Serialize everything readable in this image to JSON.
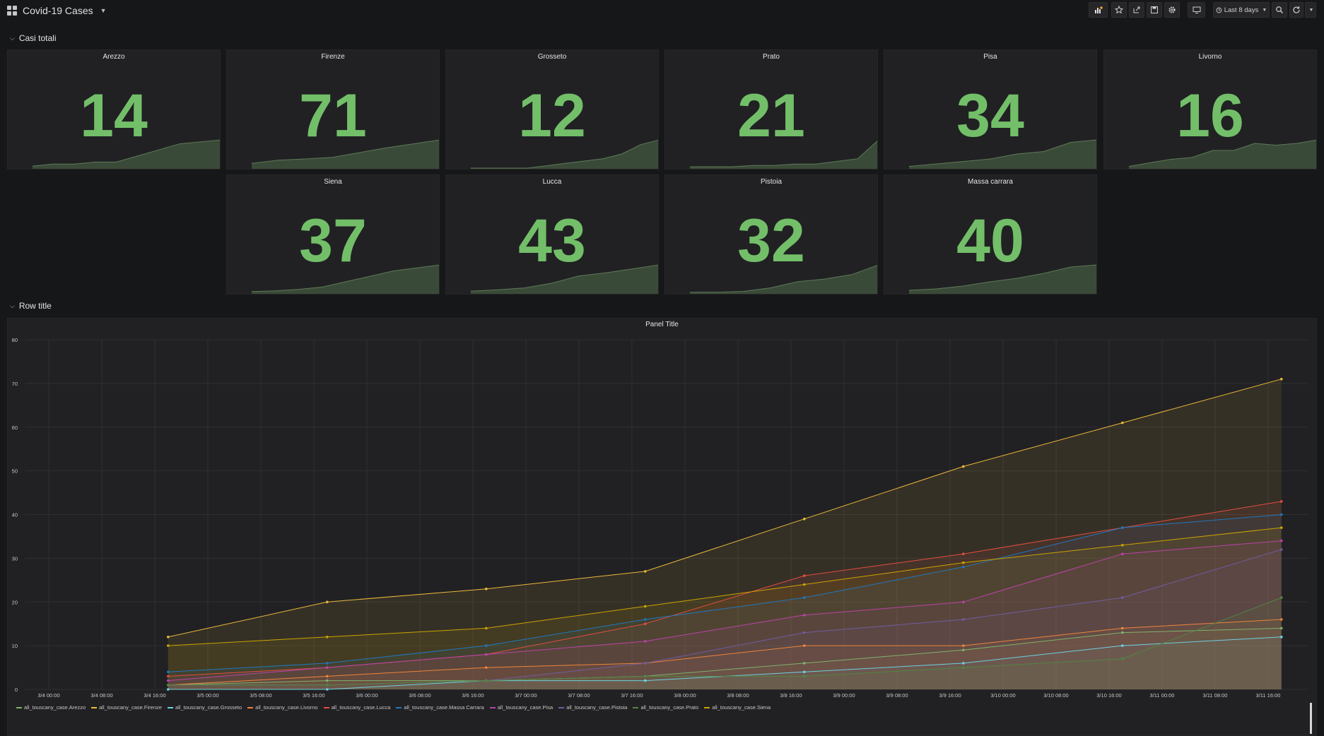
{
  "header": {
    "title": "Covid-19 Cases",
    "time_range": "Last 8 days"
  },
  "rows": [
    {
      "title": "Casi totali"
    },
    {
      "title": "Row title"
    }
  ],
  "colors": {
    "stat_value": "#73bf69",
    "sparkline_fill": "#3a4a38",
    "background": "#161719",
    "panel": "#212124"
  },
  "stats": [
    {
      "title": "Arezzo",
      "value": "14",
      "trend": [
        1,
        2,
        2,
        3,
        3,
        6,
        9,
        12,
        13,
        14
      ]
    },
    {
      "title": "Firenze",
      "value": "71",
      "trend": [
        12,
        20,
        23,
        27,
        39,
        51,
        61,
        71
      ]
    },
    {
      "title": "Grosseto",
      "value": "12",
      "trend": [
        0,
        0,
        0,
        0,
        1,
        2,
        3,
        4,
        6,
        10,
        12
      ]
    },
    {
      "title": "Prato",
      "value": "21",
      "trend": [
        1,
        1,
        1,
        2,
        2,
        3,
        3,
        5,
        7,
        21
      ]
    },
    {
      "title": "Pisa",
      "value": "34",
      "trend": [
        2,
        5,
        8,
        11,
        17,
        20,
        31,
        34
      ]
    },
    {
      "title": "Livorno",
      "value": "16",
      "trend": [
        1,
        3,
        5,
        6,
        10,
        10,
        14,
        13,
        14,
        16
      ]
    },
    {
      "title": "Siena",
      "value": "37",
      "trend": [
        2,
        3,
        5,
        8,
        15,
        22,
        29,
        33,
        37
      ]
    },
    {
      "title": "Lucca",
      "value": "43",
      "trend": [
        3,
        5,
        8,
        15,
        26,
        31,
        37,
        43
      ]
    },
    {
      "title": "Pistoia",
      "value": "32",
      "trend": [
        1,
        1,
        2,
        6,
        13,
        16,
        21,
        32
      ]
    },
    {
      "title": "Massa carrara",
      "value": "40",
      "trend": [
        4,
        6,
        10,
        16,
        21,
        28,
        37,
        40
      ]
    }
  ],
  "graph": {
    "title": "Panel Title"
  },
  "chart_data": {
    "type": "area",
    "title": "Panel Title",
    "ylim": [
      0,
      80
    ],
    "yticks": [
      0,
      10,
      20,
      30,
      40,
      50,
      60,
      70,
      80
    ],
    "xticks": [
      "3/4 00:00",
      "3/4 08:00",
      "3/4 16:00",
      "3/5 00:00",
      "3/5 08:00",
      "3/5 16:00",
      "3/6 00:00",
      "3/6 08:00",
      "3/6 16:00",
      "3/7 00:00",
      "3/7 08:00",
      "3/7 16:00",
      "3/8 00:00",
      "3/8 08:00",
      "3/8 16:00",
      "3/9 00:00",
      "3/9 08:00",
      "3/9 16:00",
      "3/10 00:00",
      "3/10 08:00",
      "3/10 16:00",
      "3/11 00:00",
      "3/11 08:00",
      "3/11 16:00"
    ],
    "x": [
      "3/4 18:00",
      "3/5 18:00",
      "3/6 18:00",
      "3/7 18:00",
      "3/8 18:00",
      "3/9 18:00",
      "3/10 18:00",
      "3/11 18:00"
    ],
    "series": [
      {
        "name": "all_touscany_case.Arezzo",
        "color": "#7eb26d",
        "values": [
          1,
          2,
          2,
          3,
          6,
          9,
          13,
          14
        ]
      },
      {
        "name": "all_touscany_case.Firenze",
        "color": "#eab839",
        "values": [
          12,
          20,
          23,
          27,
          39,
          51,
          61,
          71
        ]
      },
      {
        "name": "all_touscany_case.Grosseto",
        "color": "#6ed0e0",
        "values": [
          0,
          0,
          2,
          2,
          4,
          6,
          10,
          12
        ]
      },
      {
        "name": "all_touscany_case.Livorno",
        "color": "#ef843c",
        "values": [
          1,
          3,
          5,
          6,
          10,
          10,
          14,
          16
        ]
      },
      {
        "name": "all_touscany_case.Lucca",
        "color": "#e24d42",
        "values": [
          3,
          5,
          8,
          15,
          26,
          31,
          37,
          43
        ]
      },
      {
        "name": "all_touscany_case.Massa Carrara",
        "color": "#1f78c1",
        "values": [
          4,
          6,
          10,
          16,
          21,
          28,
          37,
          40
        ]
      },
      {
        "name": "all_touscany_case.Pisa",
        "color": "#ba43a9",
        "values": [
          2,
          5,
          8,
          11,
          17,
          20,
          31,
          34
        ]
      },
      {
        "name": "all_touscany_case.Pistoia",
        "color": "#705da0",
        "values": [
          1,
          1,
          2,
          6,
          13,
          16,
          21,
          32
        ]
      },
      {
        "name": "all_touscany_case.Prato",
        "color": "#508642",
        "values": [
          1,
          1,
          2,
          3,
          3,
          5,
          7,
          21
        ]
      },
      {
        "name": "all_touscany_case.Siena",
        "color": "#cca300",
        "values": [
          10,
          12,
          14,
          19,
          24,
          29,
          33,
          37
        ]
      }
    ],
    "grid": true,
    "legend": "bottom"
  }
}
